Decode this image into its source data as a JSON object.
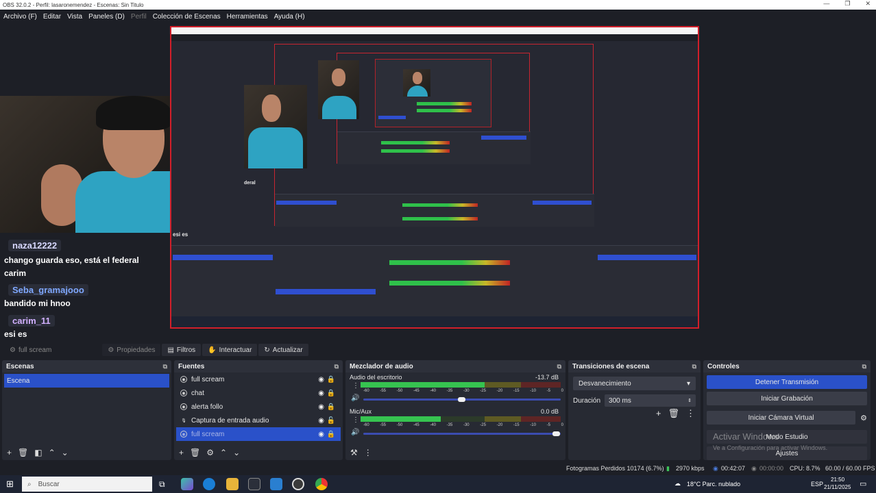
{
  "window": {
    "title": "OBS 32.0.2 - Perfil: lasaronemendez - Escenas: Sin Titulo",
    "controls": [
      "—",
      "❐",
      "✕"
    ]
  },
  "menu": {
    "items": [
      "Archivo (F)",
      "Editar",
      "Vista",
      "Paneles (D)",
      "Perfil",
      "Colección de Escenas",
      "Herramientas",
      "Ayuda (H)"
    ]
  },
  "chat": {
    "messages": [
      {
        "user": "naza12222",
        "text": "chango guarda eso, está el federal carim"
      },
      {
        "user": "Seba_gramajooo",
        "text": "bandido mi hnoo"
      },
      {
        "user": "carim_11",
        "text": "esi es"
      }
    ]
  },
  "canvas_inner": {
    "label1": "deral",
    "label2": "esi es"
  },
  "source_toolbar": {
    "selected_source": "full scream",
    "properties": "Propiedades",
    "filters": "Filtros",
    "interact": "Interactuar",
    "refresh": "Actualizar"
  },
  "scenes": {
    "title": "Escenas",
    "items": [
      "Escena"
    ]
  },
  "sources": {
    "title": "Fuentes",
    "items": [
      "full scream",
      "chat",
      "alerta follo",
      "Captura de entrada audio",
      "full scream"
    ]
  },
  "mixer": {
    "title": "Mezclador de audio",
    "tracks": [
      {
        "name": "Audio del escritorio",
        "db": "-13.7 dB",
        "level": 0.62
      },
      {
        "name": "Mic/Aux",
        "db": "0.0 dB",
        "level": 0.4
      }
    ],
    "ticks": [
      "-60",
      "-55",
      "-50",
      "-45",
      "-40",
      "-35",
      "-30",
      "-25",
      "-20",
      "-15",
      "-10",
      "-5",
      "0"
    ]
  },
  "transitions": {
    "title": "Transiciones de escena",
    "selected": "Desvanecimiento",
    "duration_label": "Duración",
    "duration_value": "300 ms"
  },
  "controls": {
    "title": "Controles",
    "stop_stream": "Detener Transmisión",
    "start_recording": "Iniciar Grabación",
    "virtual_camera": "Iniciar Cámara Virtual",
    "studio_mode": "Modo Estudio",
    "settings": "Ajustes"
  },
  "activation": {
    "line1": "Activar Windows",
    "line2": "Ve a Configuración para activar Windows."
  },
  "status": {
    "dropped": "Fotogramas Perdidos 10174 (6.7%)",
    "bitrate": "2970 kbps",
    "stream_time": "00:42:07",
    "rec_time": "00:00:00",
    "cpu": "CPU: 8.7%",
    "fps": "60.00 / 60.00 FPS"
  },
  "taskbar": {
    "search_placeholder": "Buscar",
    "weather": "18°C  Parc. nublado",
    "lang": "ESP",
    "time": "21:50",
    "date": "21/11/2025"
  },
  "colors": {
    "accent": "#2a51c9",
    "live_border": "#d21f2a",
    "bg": "#1d1f26",
    "panel": "#272a33"
  }
}
